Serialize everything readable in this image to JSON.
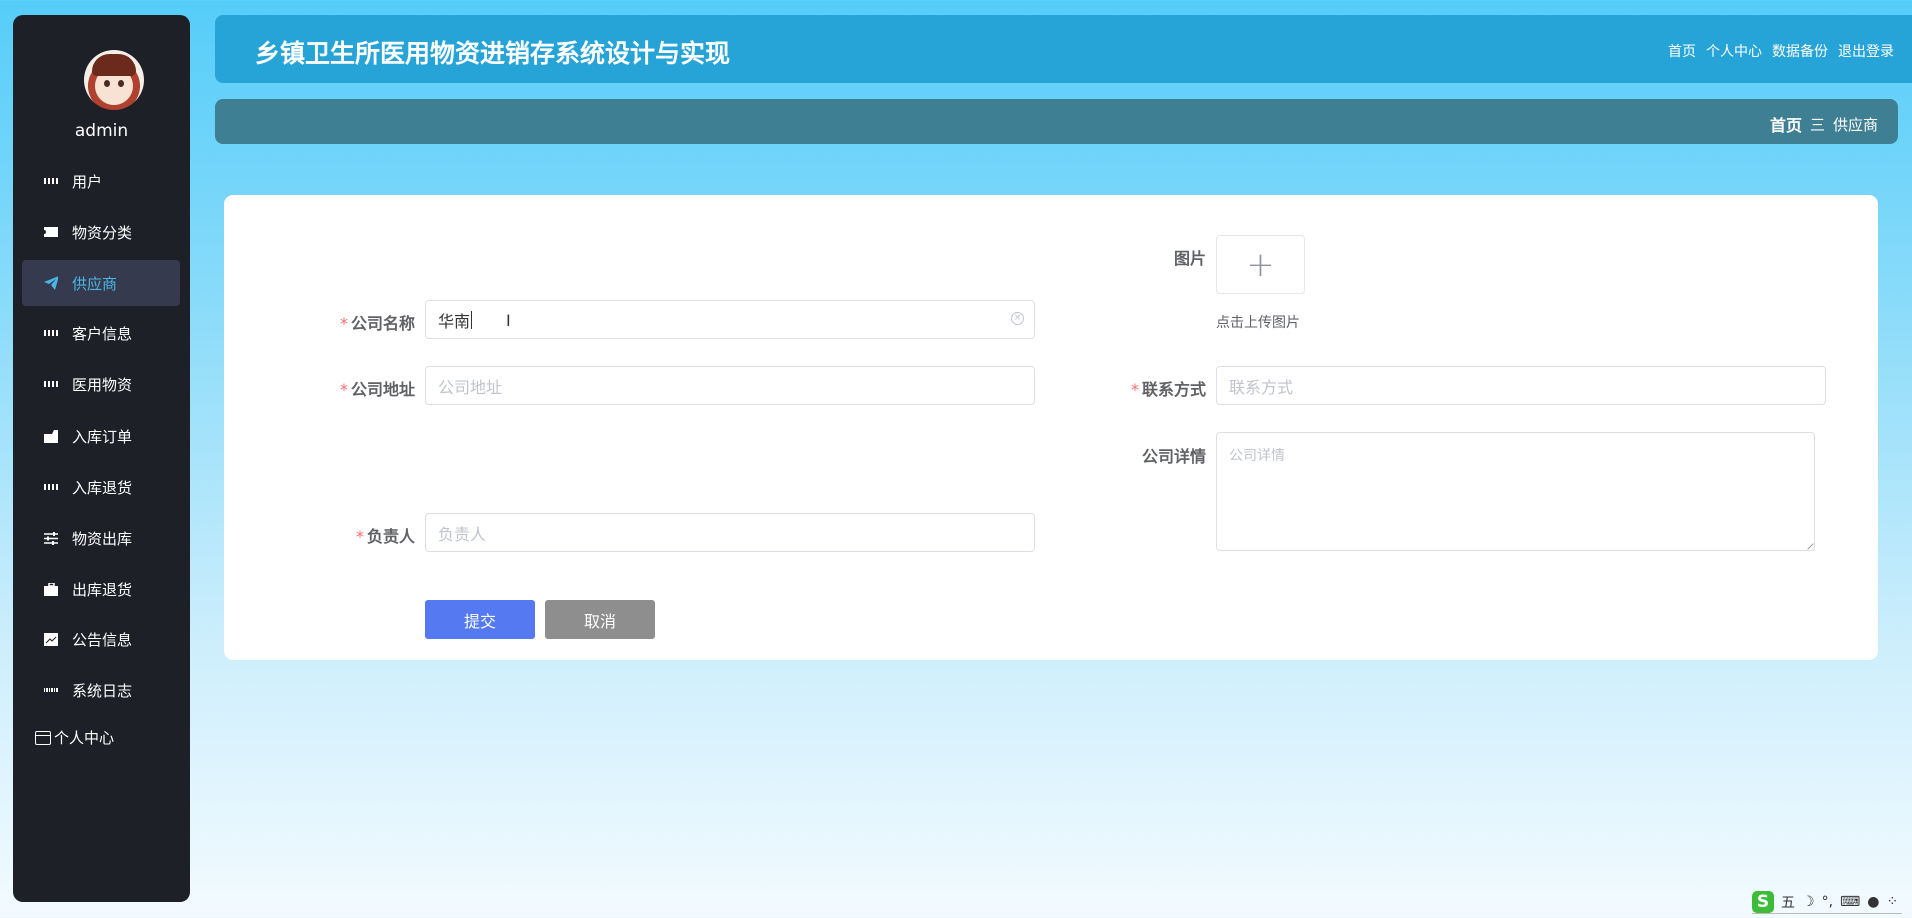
{
  "sidebar": {
    "username": "admin",
    "items": [
      {
        "label": "用户",
        "icon": "grid-icon"
      },
      {
        "label": "物资分类",
        "icon": "ticket-icon"
      },
      {
        "label": "供应商",
        "icon": "paper-plane-icon",
        "active": true
      },
      {
        "label": "客户信息",
        "icon": "grid-icon"
      },
      {
        "label": "医用物资",
        "icon": "grid-icon"
      },
      {
        "label": "入库订单",
        "icon": "inbox-icon"
      },
      {
        "label": "入库退货",
        "icon": "grid-icon"
      },
      {
        "label": "物资出库",
        "icon": "sliders-icon"
      },
      {
        "label": "出库退货",
        "icon": "briefcase-icon"
      },
      {
        "label": "公告信息",
        "icon": "chart-icon"
      },
      {
        "label": "系统日志",
        "icon": "table-icon"
      }
    ],
    "personal_center": "个人中心"
  },
  "header": {
    "title": "乡镇卫生所医用物资进销存系统设计与实现",
    "nav": [
      "首页",
      "个人中心",
      "数据备份",
      "退出登录"
    ]
  },
  "breadcrumb": {
    "home": "首页",
    "separator": "三",
    "current": "供应商"
  },
  "form": {
    "company_name": {
      "label": "公司名称",
      "value": "华南",
      "required": true
    },
    "company_address": {
      "label": "公司地址",
      "placeholder": "公司地址",
      "required": true
    },
    "person_in_charge": {
      "label": "负责人",
      "placeholder": "负责人",
      "required": true
    },
    "image": {
      "label": "图片",
      "tip": "点击上传图片"
    },
    "contact": {
      "label": "联系方式",
      "placeholder": "联系方式",
      "required": true
    },
    "details": {
      "label": "公司详情",
      "placeholder": "公司详情"
    },
    "submit_label": "提交",
    "cancel_label": "取消",
    "required_mark": "*"
  },
  "ime": {
    "mode": "五"
  },
  "colors": {
    "sidebar_bg": "#1d2027",
    "header_bg": "#27a4d7",
    "breadcrumb_bg": "#3e7f94",
    "active": "#4bb6e6",
    "submit": "#5479f0",
    "cancel": "#8e8e8e"
  }
}
